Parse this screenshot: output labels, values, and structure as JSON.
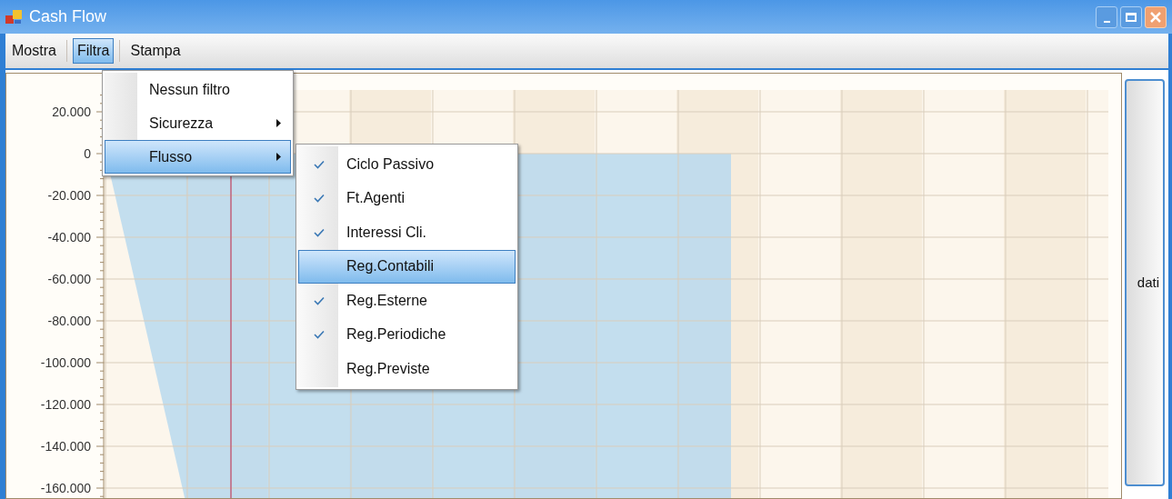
{
  "window": {
    "title": "Cash Flow"
  },
  "menu_bar": [
    {
      "label": "Mostra",
      "selected": false
    },
    {
      "label": "Filtra",
      "selected": true
    },
    {
      "label": "Stampa",
      "selected": false
    }
  ],
  "filtra_menu": [
    {
      "label": "Nessun filtro",
      "submenu": false,
      "selected": false
    },
    {
      "label": "Sicurezza",
      "submenu": true,
      "selected": false
    },
    {
      "label": "Flusso",
      "submenu": true,
      "selected": true
    }
  ],
  "flusso_submenu": [
    {
      "label": "Ciclo Passivo",
      "checked": true,
      "selected": false
    },
    {
      "label": "Ft.Agenti",
      "checked": true,
      "selected": false
    },
    {
      "label": "Interessi Cli.",
      "checked": true,
      "selected": false
    },
    {
      "label": "Reg.Contabili",
      "checked": false,
      "selected": true
    },
    {
      "label": "Reg.Esterne",
      "checked": true,
      "selected": false
    },
    {
      "label": "Reg.Periodiche",
      "checked": true,
      "selected": false
    },
    {
      "label": "Reg.Previste",
      "checked": false,
      "selected": false
    }
  ],
  "chart": {
    "y_axis_labels": [
      "20.000",
      "0",
      "-20.000",
      "-40.000",
      "-60.000",
      "-80.000",
      "-100.000",
      "-120.000",
      "-140.000",
      "-160.000"
    ]
  },
  "side_panel": {
    "label": "dati"
  }
}
